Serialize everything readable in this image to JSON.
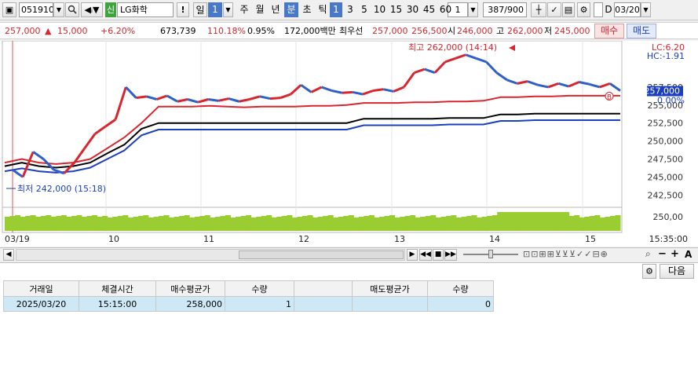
{
  "toolbar": {
    "code": "051910",
    "stock_badge": "신",
    "stock_name": "LG화학",
    "alert_label": "!",
    "period_unit_label": "일",
    "period_unit_value": "1",
    "periods": [
      "주",
      "월",
      "년",
      "분",
      "초",
      "틱"
    ],
    "selected_period": "분",
    "minute_steps": [
      "1",
      "3",
      "5",
      "10",
      "15",
      "30",
      "45",
      "60"
    ],
    "selected_step": "1",
    "count_value": "1",
    "count_display": "387/900",
    "date_checkbox_label": "D",
    "date_value": "03/20"
  },
  "info": {
    "price": "257,000",
    "change": "15,000",
    "change_pct": "+6.20%",
    "volume": "673,739",
    "volume_ratio": "110.18%",
    "turnover": "0.95%",
    "amount": "172,000백만",
    "best_quote_label": "최우선",
    "best_ask": "257,000",
    "best_bid": "256,500",
    "open_label": "시",
    "open": "246,000",
    "high_label": "고",
    "high": "262,000",
    "low_label": "저",
    "low": "245,000",
    "buy_label": "매수",
    "sell_label": "매도"
  },
  "chart_data": {
    "type": "line",
    "ylim": [
      241000,
      263500
    ],
    "y_ticks": [
      "257,500",
      "255,000",
      "252,500",
      "250,000",
      "247,500",
      "245,000",
      "242,500"
    ],
    "current_price_label": "257,000",
    "upper_right_labels": [
      "LC:6.20",
      "HC:-1.91"
    ],
    "pct_label": "0.00%",
    "high_annotation": "최고 262,000 (14:14)",
    "low_annotation": "최저 242,000 (15:18)",
    "marker_b": "B",
    "x_labels": [
      "03/19",
      "10",
      "11",
      "12",
      "13",
      "14",
      "15",
      "15:35:00"
    ],
    "volume_axis_label": "250,00",
    "series": [
      {
        "values": [
          247000,
          247500,
          247000,
          246800,
          247000,
          247500,
          249000,
          250500,
          252500,
          254800,
          254800,
          254800,
          254900,
          254800,
          254700,
          254800,
          254800,
          254800,
          254900,
          254900,
          255000,
          255300,
          255300,
          255300,
          255400,
          255400,
          255500,
          255500,
          255600,
          256100,
          256100,
          256200,
          256200,
          256300,
          256300,
          256300,
          256300
        ],
        "color": "#d8262e"
      },
      {
        "values": [
          246500,
          247000,
          246500,
          246300,
          246500,
          247000,
          248300,
          249500,
          251700,
          252500,
          252500,
          252500,
          252500,
          252500,
          252500,
          252500,
          252500,
          252500,
          252500,
          252500,
          252500,
          253100,
          253100,
          253100,
          253100,
          253100,
          253200,
          253200,
          253200,
          253700,
          253700,
          253800,
          253800,
          253800,
          253800,
          253800,
          253800
        ],
        "color": "#000000"
      },
      {
        "values": [
          245800,
          246200,
          245800,
          245600,
          245800,
          246300,
          247500,
          248700,
          250800,
          251600,
          251600,
          251600,
          251600,
          251600,
          251600,
          251600,
          251600,
          251600,
          251600,
          251600,
          251600,
          252200,
          252200,
          252200,
          252200,
          252200,
          252300,
          252300,
          252300,
          252800,
          252800,
          252900,
          252900,
          252900,
          252900,
          252900,
          252900
        ],
        "color": "#1c3fbf"
      }
    ],
    "price_path": [
      246000,
      245000,
      248500,
      247500,
      246000,
      245500,
      247000,
      249000,
      251000,
      252000,
      253000,
      257500,
      256000,
      256200,
      255800,
      256300,
      255500,
      255800,
      255400,
      255800,
      255600,
      255900,
      255500,
      255800,
      256200,
      255900,
      256000,
      256500,
      257800,
      256800,
      257500,
      257000,
      256700,
      256800,
      256500,
      257000,
      257200,
      256900,
      257500,
      259500,
      260000,
      259500,
      261000,
      261500,
      262000,
      261500,
      261000,
      259500,
      258500,
      258000,
      258300,
      257800,
      257500,
      258000,
      257600,
      258200,
      257900,
      257500,
      258000,
      257000
    ]
  },
  "scrollbar": {
    "zoom_controls": [
      "−",
      "+",
      "A"
    ]
  },
  "order_grid": {
    "next_label": "다음",
    "columns": [
      "거래일",
      "체결시간",
      "매수평균가",
      "수량",
      "",
      "매도평균가",
      "수량"
    ],
    "rows": [
      [
        "2025/03/20",
        "15:15:00",
        "258,000",
        "1",
        "",
        "",
        "0"
      ]
    ]
  },
  "colors": {
    "up": "#d8262e",
    "down": "#1c3fbf",
    "volume": "#9acd32",
    "selected": "#4a78c8"
  }
}
